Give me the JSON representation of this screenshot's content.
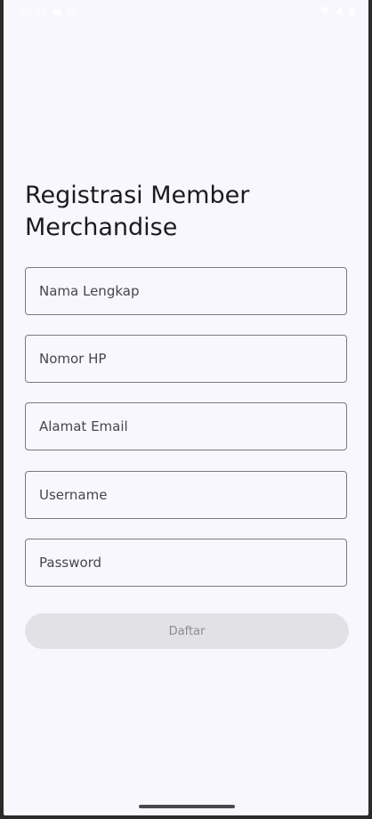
{
  "status_bar": {
    "time": "10:09",
    "left_icons": [
      "image-icon",
      "settings-icon"
    ],
    "right_icons": [
      "wifi-icon",
      "signal-icon",
      "battery-icon"
    ]
  },
  "page": {
    "title": "Registrasi Member Merchandise"
  },
  "form": {
    "fields": [
      {
        "name": "full-name-field",
        "placeholder": "Nama Lengkap"
      },
      {
        "name": "phone-field",
        "placeholder": "Nomor HP"
      },
      {
        "name": "email-field",
        "placeholder": "Alamat Email"
      },
      {
        "name": "username-field",
        "placeholder": "Username"
      },
      {
        "name": "password-field",
        "placeholder": "Password"
      }
    ],
    "submit_label": "Daftar",
    "submit_enabled": false
  },
  "colors": {
    "background": "#f8f7fd",
    "outline": "#7a7980",
    "disabled_button": "#e2e1e6",
    "disabled_text": "#8c8b91"
  }
}
